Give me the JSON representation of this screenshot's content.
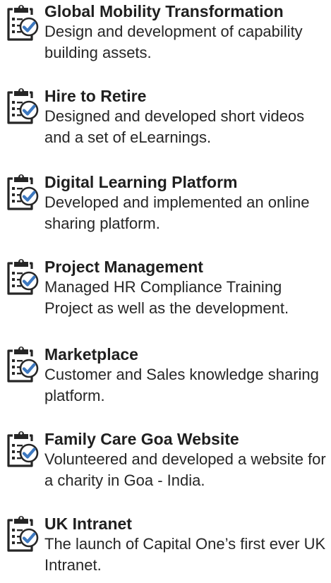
{
  "icon_name": "clipboard-checklist-icon",
  "accent_color": "#3d78bf",
  "items": [
    {
      "title": "Global Mobility Transformation",
      "description": "Design and development of capability building assets."
    },
    {
      "title": "Hire to Retire",
      "description": "Designed and developed short videos and a set of eLearnings."
    },
    {
      "title": "Digital Learning Platform",
      "description": "Developed and implemented an online sharing platform."
    },
    {
      "title": "Project Management",
      "description": "Managed HR Compliance Training Project as well as the development."
    },
    {
      "title": "Marketplace",
      "description": "Customer and Sales knowledge sharing platform."
    },
    {
      "title": "Family Care Goa Website",
      "description": "Volunteered and developed a website for a charity in Goa - India."
    },
    {
      "title": "UK Intranet",
      "description": "The launch of Capital One’s first ever UK Intranet."
    }
  ]
}
